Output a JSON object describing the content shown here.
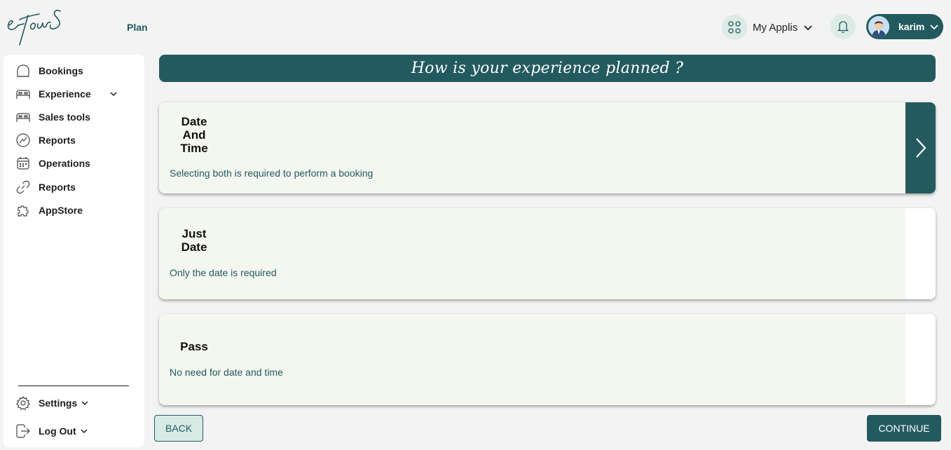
{
  "header": {
    "logo_text": "e-TourS",
    "plan_label": "Plan",
    "applis_label": "My Applis",
    "user_name": "karim"
  },
  "sidebar": {
    "items": [
      {
        "label": "Bookings",
        "icon": "bookings-icon"
      },
      {
        "label": "Experience",
        "icon": "bed-icon",
        "has_chevron": true
      },
      {
        "label": "Sales tools",
        "icon": "bed-icon"
      },
      {
        "label": "Reports",
        "icon": "chart-icon"
      },
      {
        "label": "Operations",
        "icon": "calendar-icon"
      },
      {
        "label": "Reports",
        "icon": "link-icon"
      },
      {
        "label": "AppStore",
        "icon": "puzzle-icon"
      }
    ],
    "bottom": [
      {
        "label": "Settings",
        "icon": "gear-icon"
      },
      {
        "label": "Log Out",
        "icon": "logout-icon"
      }
    ]
  },
  "main": {
    "banner": "How is your experience planned ?",
    "options": [
      {
        "title_lines": [
          "Date",
          "And",
          "Time"
        ],
        "description": "Selecting both is required to perform a booking",
        "selected": true
      },
      {
        "title_lines": [
          "Just",
          "Date"
        ],
        "description": "Only the date is required",
        "selected": false
      },
      {
        "title_lines": [
          "Pass"
        ],
        "description": "No need for date and time",
        "selected": false
      }
    ],
    "back_label": "BACK",
    "continue_label": "CONTINUE"
  },
  "colors": {
    "accent": "#235a60",
    "accent_light": "#dcebe4",
    "card_bg": "#f4f6f0",
    "page_bg": "#f3f3f3"
  }
}
